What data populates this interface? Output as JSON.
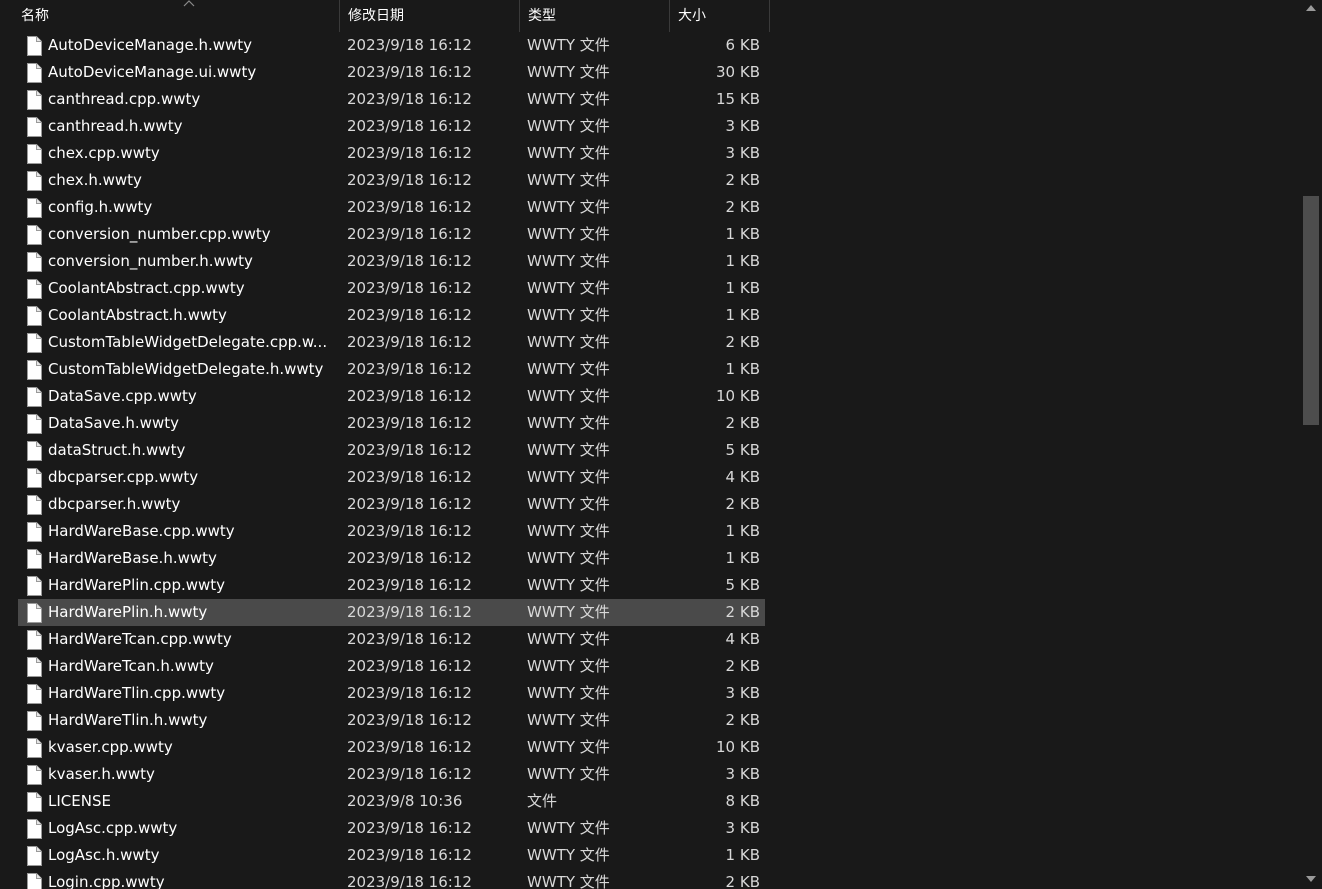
{
  "columns": {
    "name": "名称",
    "date": "修改日期",
    "type": "类型",
    "size": "大小"
  },
  "selected_index": 21,
  "files": [
    {
      "name": "AutoDeviceManage.h.wwty",
      "date": "2023/9/18 16:12",
      "type": "WWTY 文件",
      "size": "6 KB"
    },
    {
      "name": "AutoDeviceManage.ui.wwty",
      "date": "2023/9/18 16:12",
      "type": "WWTY 文件",
      "size": "30 KB"
    },
    {
      "name": "canthread.cpp.wwty",
      "date": "2023/9/18 16:12",
      "type": "WWTY 文件",
      "size": "15 KB"
    },
    {
      "name": "canthread.h.wwty",
      "date": "2023/9/18 16:12",
      "type": "WWTY 文件",
      "size": "3 KB"
    },
    {
      "name": "chex.cpp.wwty",
      "date": "2023/9/18 16:12",
      "type": "WWTY 文件",
      "size": "3 KB"
    },
    {
      "name": "chex.h.wwty",
      "date": "2023/9/18 16:12",
      "type": "WWTY 文件",
      "size": "2 KB"
    },
    {
      "name": "config.h.wwty",
      "date": "2023/9/18 16:12",
      "type": "WWTY 文件",
      "size": "2 KB"
    },
    {
      "name": "conversion_number.cpp.wwty",
      "date": "2023/9/18 16:12",
      "type": "WWTY 文件",
      "size": "1 KB"
    },
    {
      "name": "conversion_number.h.wwty",
      "date": "2023/9/18 16:12",
      "type": "WWTY 文件",
      "size": "1 KB"
    },
    {
      "name": "CoolantAbstract.cpp.wwty",
      "date": "2023/9/18 16:12",
      "type": "WWTY 文件",
      "size": "1 KB"
    },
    {
      "name": "CoolantAbstract.h.wwty",
      "date": "2023/9/18 16:12",
      "type": "WWTY 文件",
      "size": "1 KB"
    },
    {
      "name": "CustomTableWidgetDelegate.cpp.w...",
      "date": "2023/9/18 16:12",
      "type": "WWTY 文件",
      "size": "2 KB"
    },
    {
      "name": "CustomTableWidgetDelegate.h.wwty",
      "date": "2023/9/18 16:12",
      "type": "WWTY 文件",
      "size": "1 KB"
    },
    {
      "name": "DataSave.cpp.wwty",
      "date": "2023/9/18 16:12",
      "type": "WWTY 文件",
      "size": "10 KB"
    },
    {
      "name": "DataSave.h.wwty",
      "date": "2023/9/18 16:12",
      "type": "WWTY 文件",
      "size": "2 KB"
    },
    {
      "name": "dataStruct.h.wwty",
      "date": "2023/9/18 16:12",
      "type": "WWTY 文件",
      "size": "5 KB"
    },
    {
      "name": "dbcparser.cpp.wwty",
      "date": "2023/9/18 16:12",
      "type": "WWTY 文件",
      "size": "4 KB"
    },
    {
      "name": "dbcparser.h.wwty",
      "date": "2023/9/18 16:12",
      "type": "WWTY 文件",
      "size": "2 KB"
    },
    {
      "name": "HardWareBase.cpp.wwty",
      "date": "2023/9/18 16:12",
      "type": "WWTY 文件",
      "size": "1 KB"
    },
    {
      "name": "HardWareBase.h.wwty",
      "date": "2023/9/18 16:12",
      "type": "WWTY 文件",
      "size": "1 KB"
    },
    {
      "name": "HardWarePlin.cpp.wwty",
      "date": "2023/9/18 16:12",
      "type": "WWTY 文件",
      "size": "5 KB"
    },
    {
      "name": "HardWarePlin.h.wwty",
      "date": "2023/9/18 16:12",
      "type": "WWTY 文件",
      "size": "2 KB"
    },
    {
      "name": "HardWareTcan.cpp.wwty",
      "date": "2023/9/18 16:12",
      "type": "WWTY 文件",
      "size": "4 KB"
    },
    {
      "name": "HardWareTcan.h.wwty",
      "date": "2023/9/18 16:12",
      "type": "WWTY 文件",
      "size": "2 KB"
    },
    {
      "name": "HardWareTlin.cpp.wwty",
      "date": "2023/9/18 16:12",
      "type": "WWTY 文件",
      "size": "3 KB"
    },
    {
      "name": "HardWareTlin.h.wwty",
      "date": "2023/9/18 16:12",
      "type": "WWTY 文件",
      "size": "2 KB"
    },
    {
      "name": "kvaser.cpp.wwty",
      "date": "2023/9/18 16:12",
      "type": "WWTY 文件",
      "size": "10 KB"
    },
    {
      "name": "kvaser.h.wwty",
      "date": "2023/9/18 16:12",
      "type": "WWTY 文件",
      "size": "3 KB"
    },
    {
      "name": "LICENSE",
      "date": "2023/9/8 10:36",
      "type": "文件",
      "size": "8 KB"
    },
    {
      "name": "LogAsc.cpp.wwty",
      "date": "2023/9/18 16:12",
      "type": "WWTY 文件",
      "size": "3 KB"
    },
    {
      "name": "LogAsc.h.wwty",
      "date": "2023/9/18 16:12",
      "type": "WWTY 文件",
      "size": "1 KB"
    },
    {
      "name": "Login.cpp.wwty",
      "date": "2023/9/18 16:12",
      "type": "WWTY 文件",
      "size": "2 KB"
    }
  ],
  "icons": {
    "sort": "sort-up-icon",
    "file": "file-icon",
    "scroll_up": "scroll-up-icon",
    "scroll_down": "scroll-down-icon"
  },
  "colors": {
    "background": "#191919",
    "selected_row": "#4a4a4a",
    "text": "#ffffff",
    "scroll_thumb": "#4d4d4d"
  }
}
